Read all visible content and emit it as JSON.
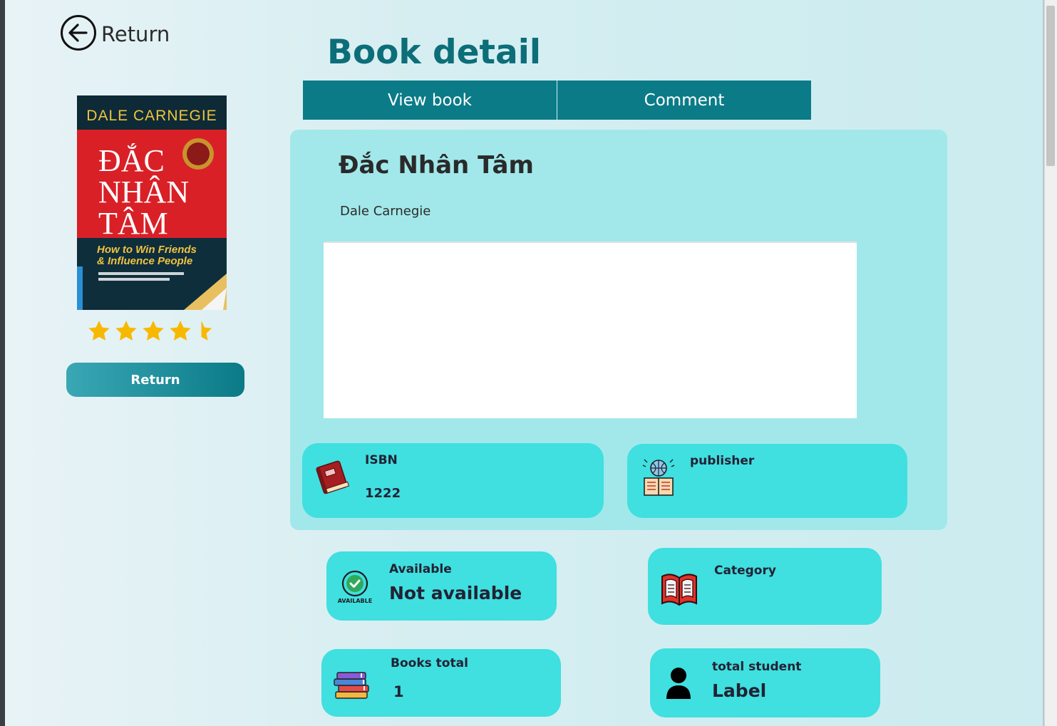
{
  "nav": {
    "back_label": "Return"
  },
  "header": {
    "title": "Book detail"
  },
  "tabs": [
    {
      "label": "View book"
    },
    {
      "label": "Comment"
    }
  ],
  "book": {
    "title": "Đắc Nhân Tâm",
    "author": "Dale Carnegie",
    "rating": 4.5,
    "rating_max": 5,
    "cover": {
      "top_text": "DALE CARNEGIE",
      "title_lines": [
        "ĐẮC",
        "NHÂN",
        "TÂM"
      ],
      "subtitle": "How to Win Friends & Influence People"
    }
  },
  "left_panel": {
    "return_button": "Return"
  },
  "info": {
    "isbn": {
      "label": "ISBN",
      "value": "1222",
      "icon": "book-icon"
    },
    "publisher": {
      "label": "publisher",
      "value": "",
      "icon": "publisher-icon"
    },
    "available": {
      "label": "Available",
      "value": "Not available",
      "icon": "available-badge-icon",
      "badge_text": "AVAILABLE"
    },
    "category": {
      "label": "Category",
      "value": "",
      "icon": "open-book-icon"
    },
    "books_total": {
      "label": "Books total",
      "value": "1",
      "icon": "book-stack-icon"
    },
    "total_student": {
      "label": "total student",
      "value": "Label",
      "icon": "person-icon"
    }
  },
  "colors": {
    "accent": "#0b7b88",
    "title": "#0c6e79",
    "panel": "#a2e8ea",
    "card": "#40dfe0",
    "star": "#f8b800"
  }
}
